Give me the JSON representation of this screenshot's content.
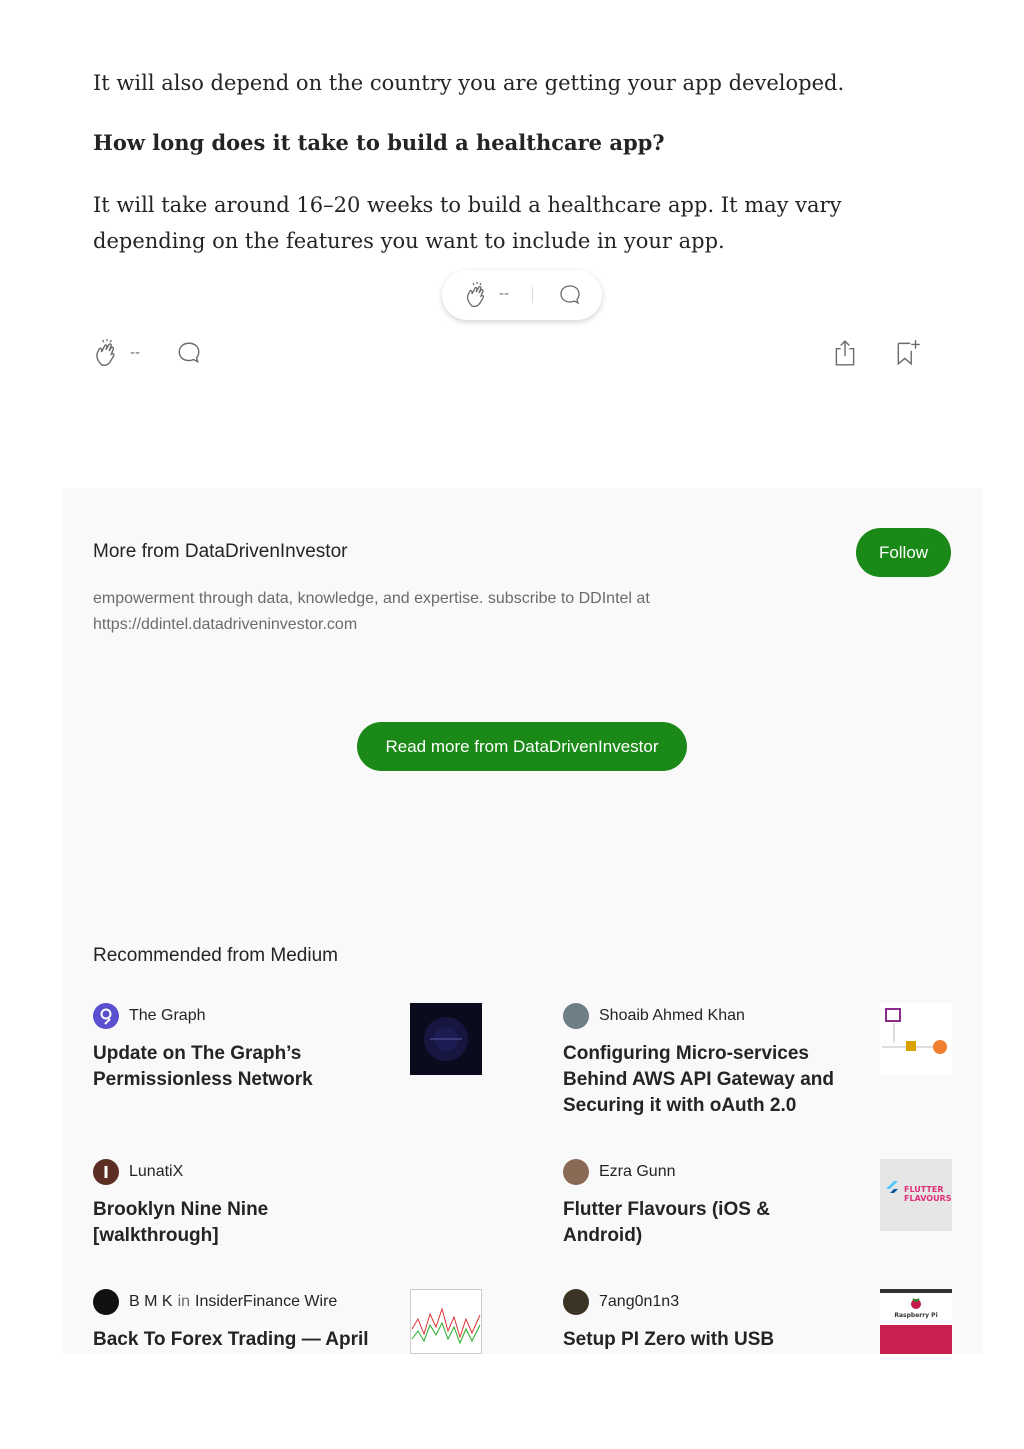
{
  "article": {
    "para1": "It will also depend on the country you are getting your app developed.",
    "heading": "How long does it take to build a healthcare app?",
    "para2": "It will take around 16–20 weeks to build a healthcare app. It may vary depending on the features you want to include in your app."
  },
  "floating_bar": {
    "clap_count": "--"
  },
  "action_bar": {
    "clap_count": "--"
  },
  "more_from": {
    "title": "More from DataDrivenInvestor",
    "follow_label": "Follow",
    "description": "empowerment through data, knowledge, and expertise. subscribe to DDIntel at https://ddintel.datadriveninvestor.com",
    "read_more_label": "Read more from DataDrivenInvestor"
  },
  "recommended": {
    "title": "Recommended from Medium",
    "cards": [
      {
        "author": "The Graph",
        "publication": "",
        "in_label": "",
        "title": "Update on The Graph’s Permissionless Network",
        "avatar_color": "#5a4fcf",
        "thumb_color": "#0b0b1e"
      },
      {
        "author": "Shoaib Ahmed Khan",
        "publication": "",
        "in_label": "",
        "title": "Configuring Micro-services Behind AWS API Gateway and Securing it with oAuth 2.0",
        "avatar_color": "#6f7d86",
        "thumb_color": "#ffffff"
      },
      {
        "author": "LunatiX",
        "publication": "",
        "in_label": "",
        "title": "Brooklyn Nine Nine [walkthrough]",
        "avatar_color": "#5c2e24",
        "thumb_color": ""
      },
      {
        "author": "Ezra Gunn",
        "publication": "",
        "in_label": "",
        "title": "Flutter Flavours (iOS & Android)",
        "avatar_color": "#8a6a55",
        "thumb_color": "#e6e6e6",
        "thumb_text_1": "FLUTTER",
        "thumb_text_2": "FLAVOURS"
      },
      {
        "author": "B M K",
        "publication": "InsiderFinance Wire",
        "in_label": "in",
        "title": "Back To Forex Trading — April",
        "avatar_color": "#111111",
        "thumb_color": "#ffffff"
      },
      {
        "author": "7ang0n1n3",
        "publication": "",
        "in_label": "",
        "title": "Setup PI Zero with USB",
        "avatar_color": "#3b3324",
        "thumb_color": "#c8204f",
        "thumb_text_1": "Raspberry Pi"
      }
    ]
  },
  "colors": {
    "accent_green": "#1a8917",
    "panel_bg": "#f9f9f9",
    "muted_text": "#6b6b6b"
  }
}
